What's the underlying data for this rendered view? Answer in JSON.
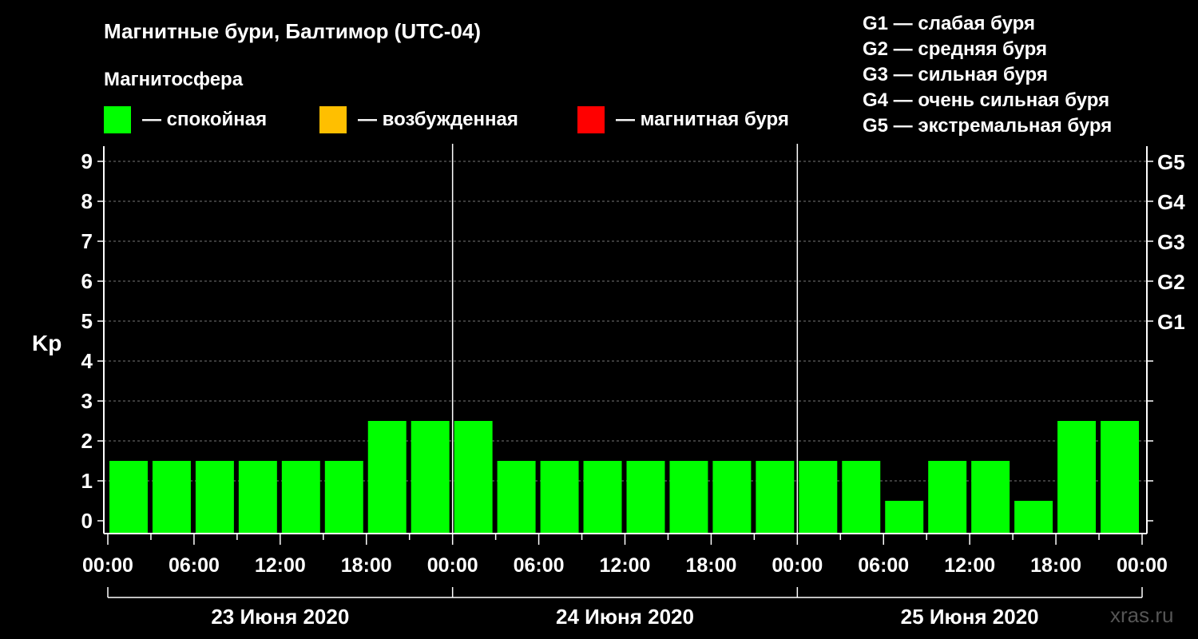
{
  "header": {
    "title": "Магнитные бури, Балтимор (UTC-04)",
    "subtitle": "Магнитосфера",
    "legend": [
      {
        "label": "— спокойная",
        "color": "#00ff00"
      },
      {
        "label": "— возбужденная",
        "color": "#ffbf00"
      },
      {
        "label": "— магнитная буря",
        "color": "#ff0000"
      }
    ]
  },
  "g_scale": [
    "G1 — слабая буря",
    "G2 — средняя буря",
    "G3 — сильная буря",
    "G4 — очень сильная буря",
    "G5 — экстремальная буря"
  ],
  "watermark": "xras.ru",
  "chart_data": {
    "type": "bar",
    "ylabel": "Kp",
    "ylim": [
      0,
      9
    ],
    "yticks": [
      "0",
      "1",
      "2",
      "3",
      "4",
      "5",
      "6",
      "7",
      "8",
      "9"
    ],
    "right_axis_labels": [
      {
        "value": 5,
        "label": "G1"
      },
      {
        "value": 6,
        "label": "G2"
      },
      {
        "value": 7,
        "label": "G3"
      },
      {
        "value": 8,
        "label": "G4"
      },
      {
        "value": 9,
        "label": "G5"
      }
    ],
    "xticks": [
      "00:00",
      "06:00",
      "12:00",
      "18:00",
      "00:00",
      "06:00",
      "12:00",
      "18:00",
      "00:00",
      "06:00",
      "12:00",
      "18:00",
      "00:00"
    ],
    "days": [
      "23 Июня 2020",
      "24 Июня 2020",
      "25 Июня 2020"
    ],
    "bar_color": "#00ff00",
    "grid": "dashed horizontal",
    "values": [
      1,
      1,
      1,
      1,
      1,
      1,
      2,
      2,
      2,
      1,
      1,
      1,
      1,
      1,
      1,
      1,
      1,
      1,
      0,
      1,
      1,
      0,
      2,
      2
    ]
  }
}
